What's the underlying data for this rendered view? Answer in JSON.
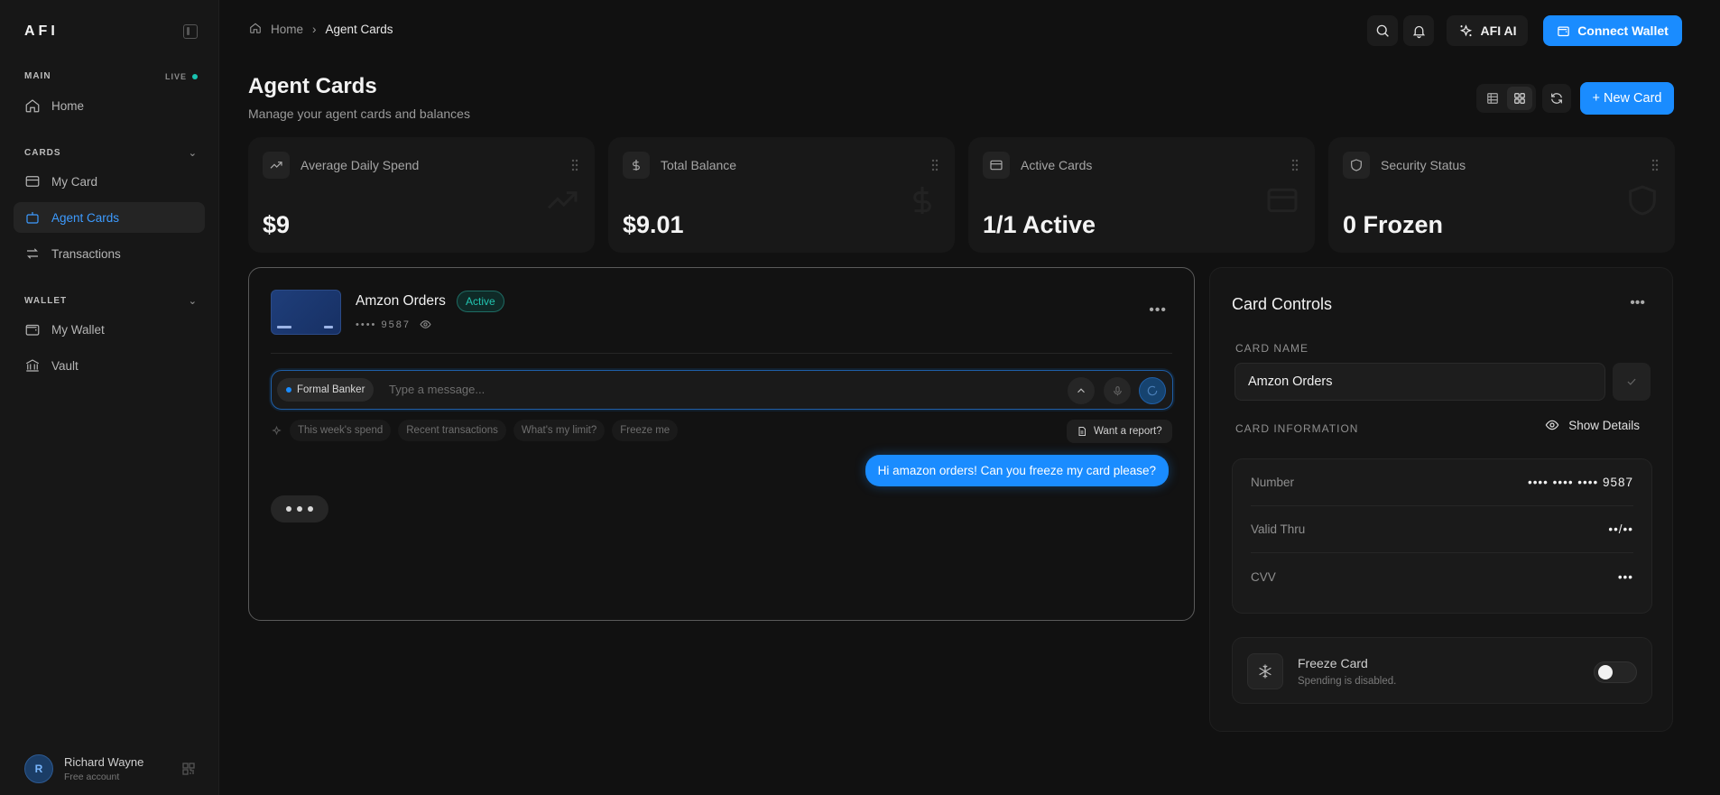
{
  "sidebar": {
    "logo": "AFI",
    "sections": {
      "main": {
        "label": "MAIN",
        "live": "LIVE"
      },
      "cards": {
        "label": "CARDS"
      },
      "wallet": {
        "label": "WALLET"
      }
    },
    "items": {
      "home": "Home",
      "my_card": "My Card",
      "agent_cards": "Agent Cards",
      "transactions": "Transactions",
      "my_wallet": "My Wallet",
      "vault": "Vault"
    },
    "user": {
      "initial": "R",
      "name": "Richard Wayne",
      "plan": "Free account"
    }
  },
  "topbar": {
    "breadcrumb": {
      "home": "Home",
      "current": "Agent Cards"
    },
    "afi_ai": "AFI AI",
    "connect_wallet": "Connect Wallet"
  },
  "page": {
    "title": "Agent Cards",
    "subtitle": "Manage your agent cards and balances",
    "new_card": "+ New Card"
  },
  "stats": [
    {
      "label": "Average Daily Spend",
      "value": "$9"
    },
    {
      "label": "Total Balance",
      "value": "$9.01"
    },
    {
      "label": "Active Cards",
      "value": "1/1 Active"
    },
    {
      "label": "Security Status",
      "value": "0 Frozen"
    }
  ],
  "chat": {
    "card_name": "Amzon Orders",
    "status": "Active",
    "card_number": "•••• 9587",
    "persona": "Formal Banker",
    "placeholder": "Type a message...",
    "chips": [
      "This week's spend",
      "Recent transactions",
      "What's my limit?",
      "Freeze me"
    ],
    "report": "Want a report?",
    "user_message": "Hi amazon orders! Can you freeze my card please?"
  },
  "controls": {
    "title": "Card Controls",
    "card_name_label": "CARD NAME",
    "card_name_value": "Amzon Orders",
    "card_info_label": "CARD INFORMATION",
    "show_details": "Show Details",
    "number_label": "Number",
    "number_value": "•••• •••• •••• 9587",
    "valid_label": "Valid Thru",
    "valid_value": "••/••",
    "cvv_label": "CVV",
    "cvv_value": "•••",
    "freeze_title": "Freeze Card",
    "freeze_sub": "Spending is disabled.",
    "freeze_on": false
  },
  "colors": {
    "accent": "#1a8cff",
    "active_green": "#22c4b0",
    "background": "#111111"
  }
}
